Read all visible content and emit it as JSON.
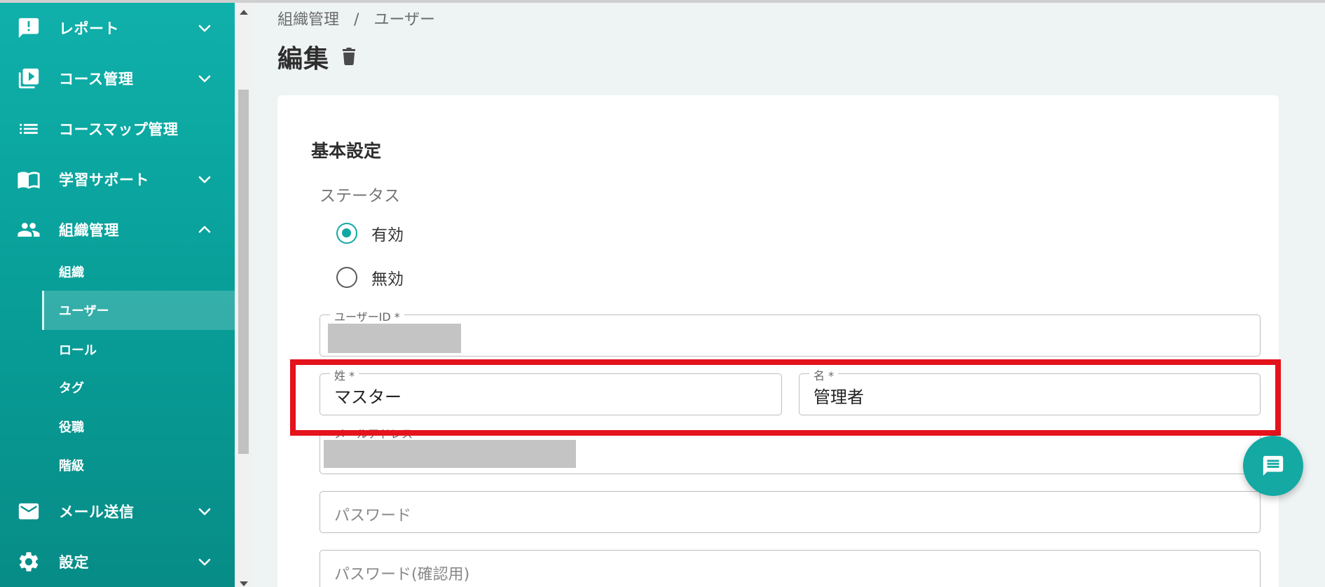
{
  "sidebar": {
    "items": [
      {
        "label": "レポート",
        "icon": "report-icon",
        "expanded": false
      },
      {
        "label": "コース管理",
        "icon": "course-icon",
        "expanded": false
      },
      {
        "label": "コースマップ管理",
        "icon": "list-icon"
      },
      {
        "label": "学習サポート",
        "icon": "book-icon",
        "expanded": false
      },
      {
        "label": "組織管理",
        "icon": "people-icon",
        "expanded": true
      },
      {
        "label": "メール送信",
        "icon": "mail-icon",
        "expanded": false
      },
      {
        "label": "設定",
        "icon": "gear-icon",
        "expanded": false
      }
    ],
    "subitems": [
      {
        "label": "組織"
      },
      {
        "label": "ユーザー",
        "active": true
      },
      {
        "label": "ロール"
      },
      {
        "label": "タグ"
      },
      {
        "label": "役職"
      },
      {
        "label": "階級"
      }
    ]
  },
  "breadcrumb": {
    "parent": "組織管理",
    "separator": "/",
    "current": "ユーザー"
  },
  "page": {
    "title": "編集"
  },
  "form": {
    "section_title": "基本設定",
    "status_label": "ステータス",
    "status_options": [
      {
        "label": "有効",
        "checked": true
      },
      {
        "label": "無効",
        "checked": false
      }
    ],
    "user_id_label": "ユーザーID *",
    "last_name_label": "姓 *",
    "last_name_value": "マスター",
    "first_name_label": "名 *",
    "first_name_value": "管理者",
    "email_label": "メールアドレス",
    "password_placeholder": "パスワード",
    "password_confirm_placeholder": "パスワード(確認用)"
  },
  "colors": {
    "accent": "#11a8a3",
    "highlight": "#e4131c"
  }
}
